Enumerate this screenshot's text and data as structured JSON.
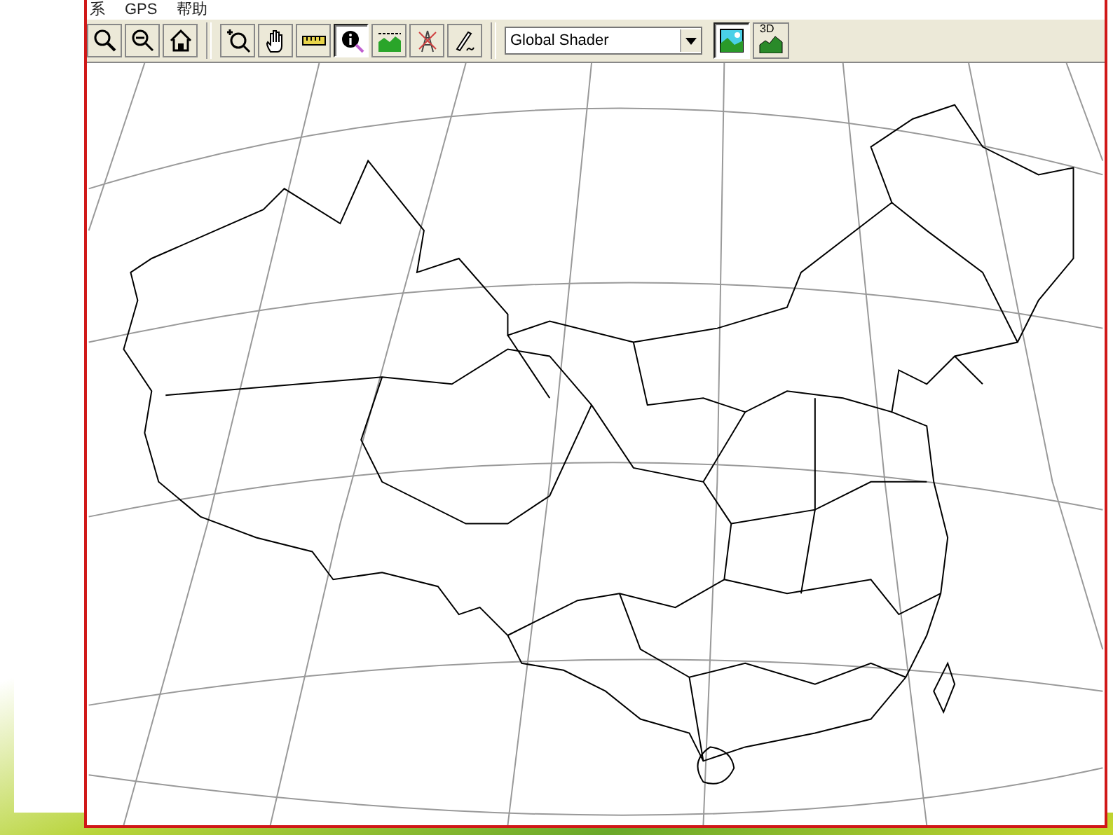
{
  "menu": [
    {
      "label": "系"
    },
    {
      "label": "GPS"
    },
    {
      "label": "帮助"
    }
  ],
  "toolbar": {
    "tools": [
      {
        "kind": "zoom-in",
        "selected": false
      },
      {
        "kind": "zoom-out",
        "selected": false
      },
      {
        "kind": "home",
        "selected": false
      },
      {
        "kind": "separator"
      },
      {
        "kind": "zoom-box",
        "selected": false
      },
      {
        "kind": "pan",
        "selected": false
      },
      {
        "kind": "ruler",
        "selected": false
      },
      {
        "kind": "info",
        "selected": true
      },
      {
        "kind": "profile",
        "selected": false
      },
      {
        "kind": "tower",
        "selected": false
      },
      {
        "kind": "pen",
        "selected": false
      }
    ],
    "shader": {
      "value": "Global Shader"
    },
    "view_buttons": [
      {
        "kind": "image",
        "selected": true
      },
      {
        "kind": "terrain",
        "label": "3D",
        "selected": false
      }
    ]
  }
}
